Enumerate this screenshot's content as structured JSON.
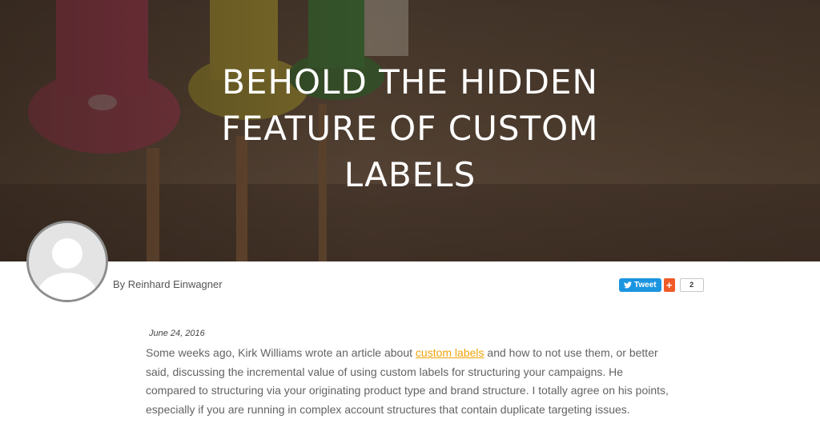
{
  "article": {
    "title_line1": "BEHOLD THE HIDDEN",
    "title_line2": "FEATURE OF CUSTOM",
    "title_line3": "LABELS",
    "author": "By Reinhard Einwagner",
    "date": "June 24, 2016",
    "body_intro": "Some weeks ago, Kirk Williams wrote an article about ",
    "body_link": "custom labels",
    "body_rest": " and how to not use them, or better said, discussing the incremental value of using custom labels for structuring your campaigns. He compared to structuring via your originating product type and brand structure. I totally agree on his points, especially if you are running in complex account structures that contain duplicate targeting issues."
  },
  "share": {
    "tweet_label": "Tweet",
    "plus_label": "+",
    "count": "2",
    "twitter_color": "#1b95e0",
    "addthis_color": "#f05a28"
  },
  "colors": {
    "link": "#f0a30a",
    "body_text": "#636363"
  },
  "icons": [
    "avatar-placeholder-icon",
    "twitter-bird-icon",
    "plus-icon"
  ]
}
